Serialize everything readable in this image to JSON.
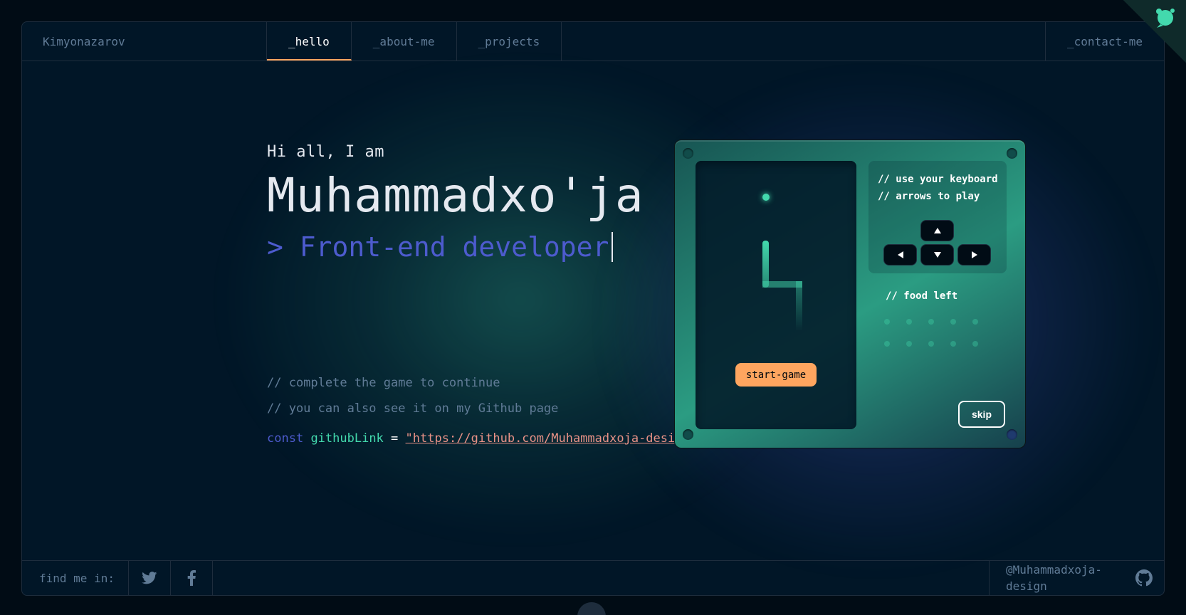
{
  "header": {
    "brand": "Kimyonazarov",
    "tabs": [
      {
        "label": "_hello",
        "active": true
      },
      {
        "label": "_about-me",
        "active": false
      },
      {
        "label": "_projects",
        "active": false
      }
    ],
    "contact": "_contact-me"
  },
  "hero": {
    "greeting": "Hi all, I am",
    "name": "Muhammadxo'ja",
    "role": "> Front-end developer"
  },
  "comments": {
    "line1": "// complete the game to continue",
    "line2": "// you can also see it on my Github page",
    "code_keyword": "const",
    "code_var": "githubLink",
    "code_eq": "=",
    "code_value": "\"https://github.com/Muhammadxoja-design\""
  },
  "game": {
    "hint_line1": "// use your keyboard",
    "hint_line2": "// arrows to play",
    "start_label": "start-game",
    "food_left_label": "// food left",
    "food_left_count": 10,
    "skip_label": "skip"
  },
  "footer": {
    "find_label": "find me in:",
    "social": [
      "twitter-icon",
      "facebook-icon"
    ],
    "github_handle": "@Muhammadxoja-design"
  },
  "colors": {
    "background": "#010c15",
    "panel": "#011627",
    "accent_orange": "#fea55f",
    "accent_green": "#43d9ad",
    "accent_blue": "#4d5bce",
    "text_muted": "#607b96",
    "string": "#e99287"
  }
}
